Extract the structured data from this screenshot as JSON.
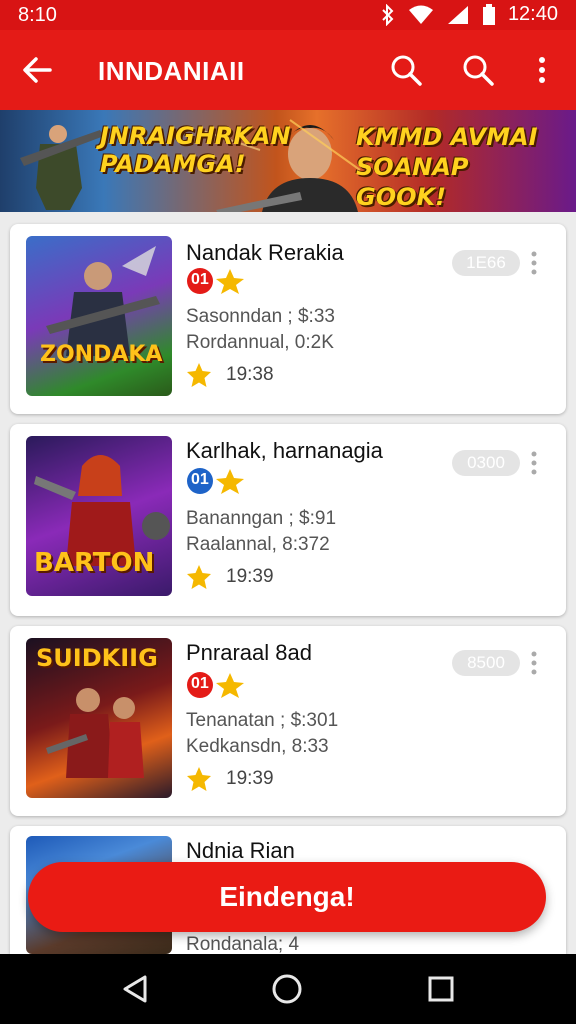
{
  "status": {
    "time": "8:10",
    "clock_right": "12:40"
  },
  "appbar": {
    "title": "INNDANIAII",
    "back_icon": "arrow-left-icon",
    "search_icon": "search-icon",
    "more_icon": "more-vert-icon"
  },
  "banner": {
    "left_text": "JNRAIGHRKAN PADAMGA!",
    "right_text": "KMMD AVMAI SOANAP GOOK!"
  },
  "items": [
    {
      "name": "Nandak Rerakia",
      "badge": "01",
      "line1": "Sasonndan ; $:33",
      "line2": "Rordannual, 0:2K",
      "rating": "19:38",
      "pill": "1E66",
      "thumb_title": "ZONDAKA"
    },
    {
      "name": "Karlhak, harnanagia",
      "badge": "01",
      "line1": "Bananngan ; $:91",
      "line2": "Raalannal, 8:372",
      "rating": "19:39",
      "pill": "0300",
      "thumb_title": "BARTON"
    },
    {
      "name": "Pnraraal 8ad",
      "badge": "01",
      "line1": "Tenanatan ; $:301",
      "line2": "Kedkansdn, 8:33",
      "rating": "19:39",
      "pill": "8500",
      "thumb_title": "SUIDKIIG"
    },
    {
      "name": "Ndnia Rian",
      "line2": "Rondanala; 4"
    }
  ],
  "cta": {
    "label": "Eindenga!"
  },
  "colors": {
    "primary": "#e41b17",
    "status": "#d81414",
    "star": "#f5b800"
  }
}
